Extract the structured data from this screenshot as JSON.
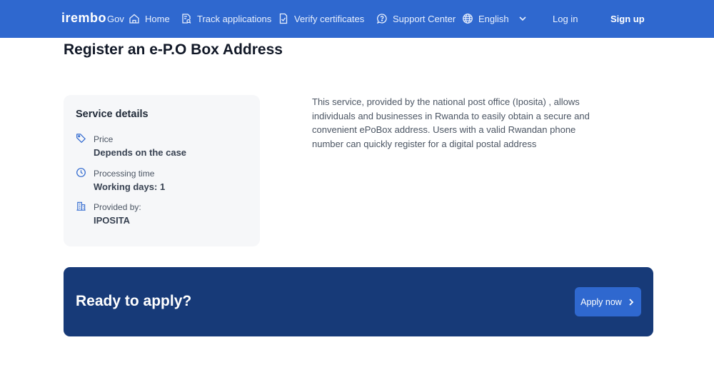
{
  "header": {
    "logo": {
      "main": "irembo",
      "suffix": "Gov"
    },
    "nav": {
      "home": "Home",
      "track": "Track applications",
      "verify": "Verify certificates",
      "support": "Support Center",
      "language": "English"
    },
    "login": "Log in",
    "signup": "Sign up"
  },
  "page": {
    "title": "Register an e-P.O Box Address"
  },
  "service_details": {
    "heading": "Service details",
    "price": {
      "label": "Price",
      "value": "Depends on the case",
      "icon": "tag-icon"
    },
    "processing_time": {
      "label": "Processing time",
      "value": "Working days: 1",
      "icon": "clock-icon"
    },
    "provider": {
      "label": "Provided by:",
      "value": "IPOSITA",
      "icon": "building-icon"
    }
  },
  "description": "This service, provided by the national post office (Iposita) , allows individuals and businesses in Rwanda to easily obtain a secure and convenient ePoBox address. Users with a valid Rwandan phone number can quickly register for a digital postal address",
  "cta": {
    "title": "Ready to apply?",
    "button": "Apply now"
  },
  "colors": {
    "header_bg": "#2f68cf",
    "banner_bg": "#173a78",
    "card_bg": "#f6f7f9",
    "accent": "#2f68cf"
  }
}
